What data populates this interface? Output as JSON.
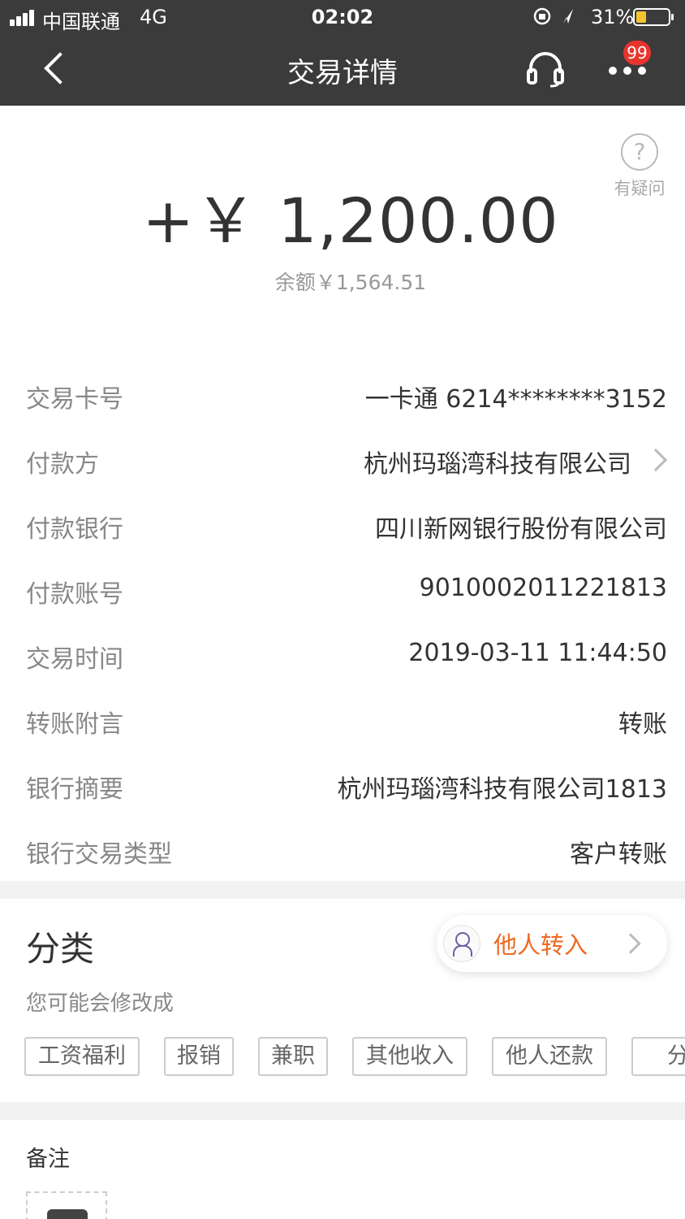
{
  "status_bar": {
    "carrier": "中国联通",
    "network": "4G",
    "time": "02:02",
    "battery": "31%",
    "battery_level": 0.31
  },
  "nav": {
    "title": "交易详情",
    "badge": "99"
  },
  "summary": {
    "amount": "+￥ 1,200.00",
    "balance": "余额￥1,564.51",
    "help_label": "有疑问"
  },
  "details": [
    {
      "label": "交易卡号",
      "value": "一卡通 6214********3152"
    },
    {
      "label": "付款方",
      "value": "杭州玛瑙湾科技有限公司"
    },
    {
      "label": "付款银行",
      "value": "四川新网银行股份有限公司"
    },
    {
      "label": "付款账号",
      "value": "9010002011221813"
    },
    {
      "label": "交易时间",
      "value": "2019-03-11 11:44:50"
    },
    {
      "label": "转账附言",
      "value": "转账"
    },
    {
      "label": "银行摘要",
      "value": "杭州玛瑙湾科技有限公司1813"
    },
    {
      "label": "银行交易类型",
      "value": "客户转账"
    }
  ],
  "category": {
    "title": "分类",
    "selected": "他人转入",
    "hint": "您可能会修改成",
    "tags": [
      "工资福利",
      "报销",
      "兼职",
      "其他收入",
      "他人还款",
      "分红"
    ]
  },
  "remarks": {
    "title": "备注"
  },
  "colors": {
    "topbar": "#3b3b3b",
    "accent": "#ec6a22",
    "badge": "#e8342d",
    "battery": "#f4c430"
  }
}
